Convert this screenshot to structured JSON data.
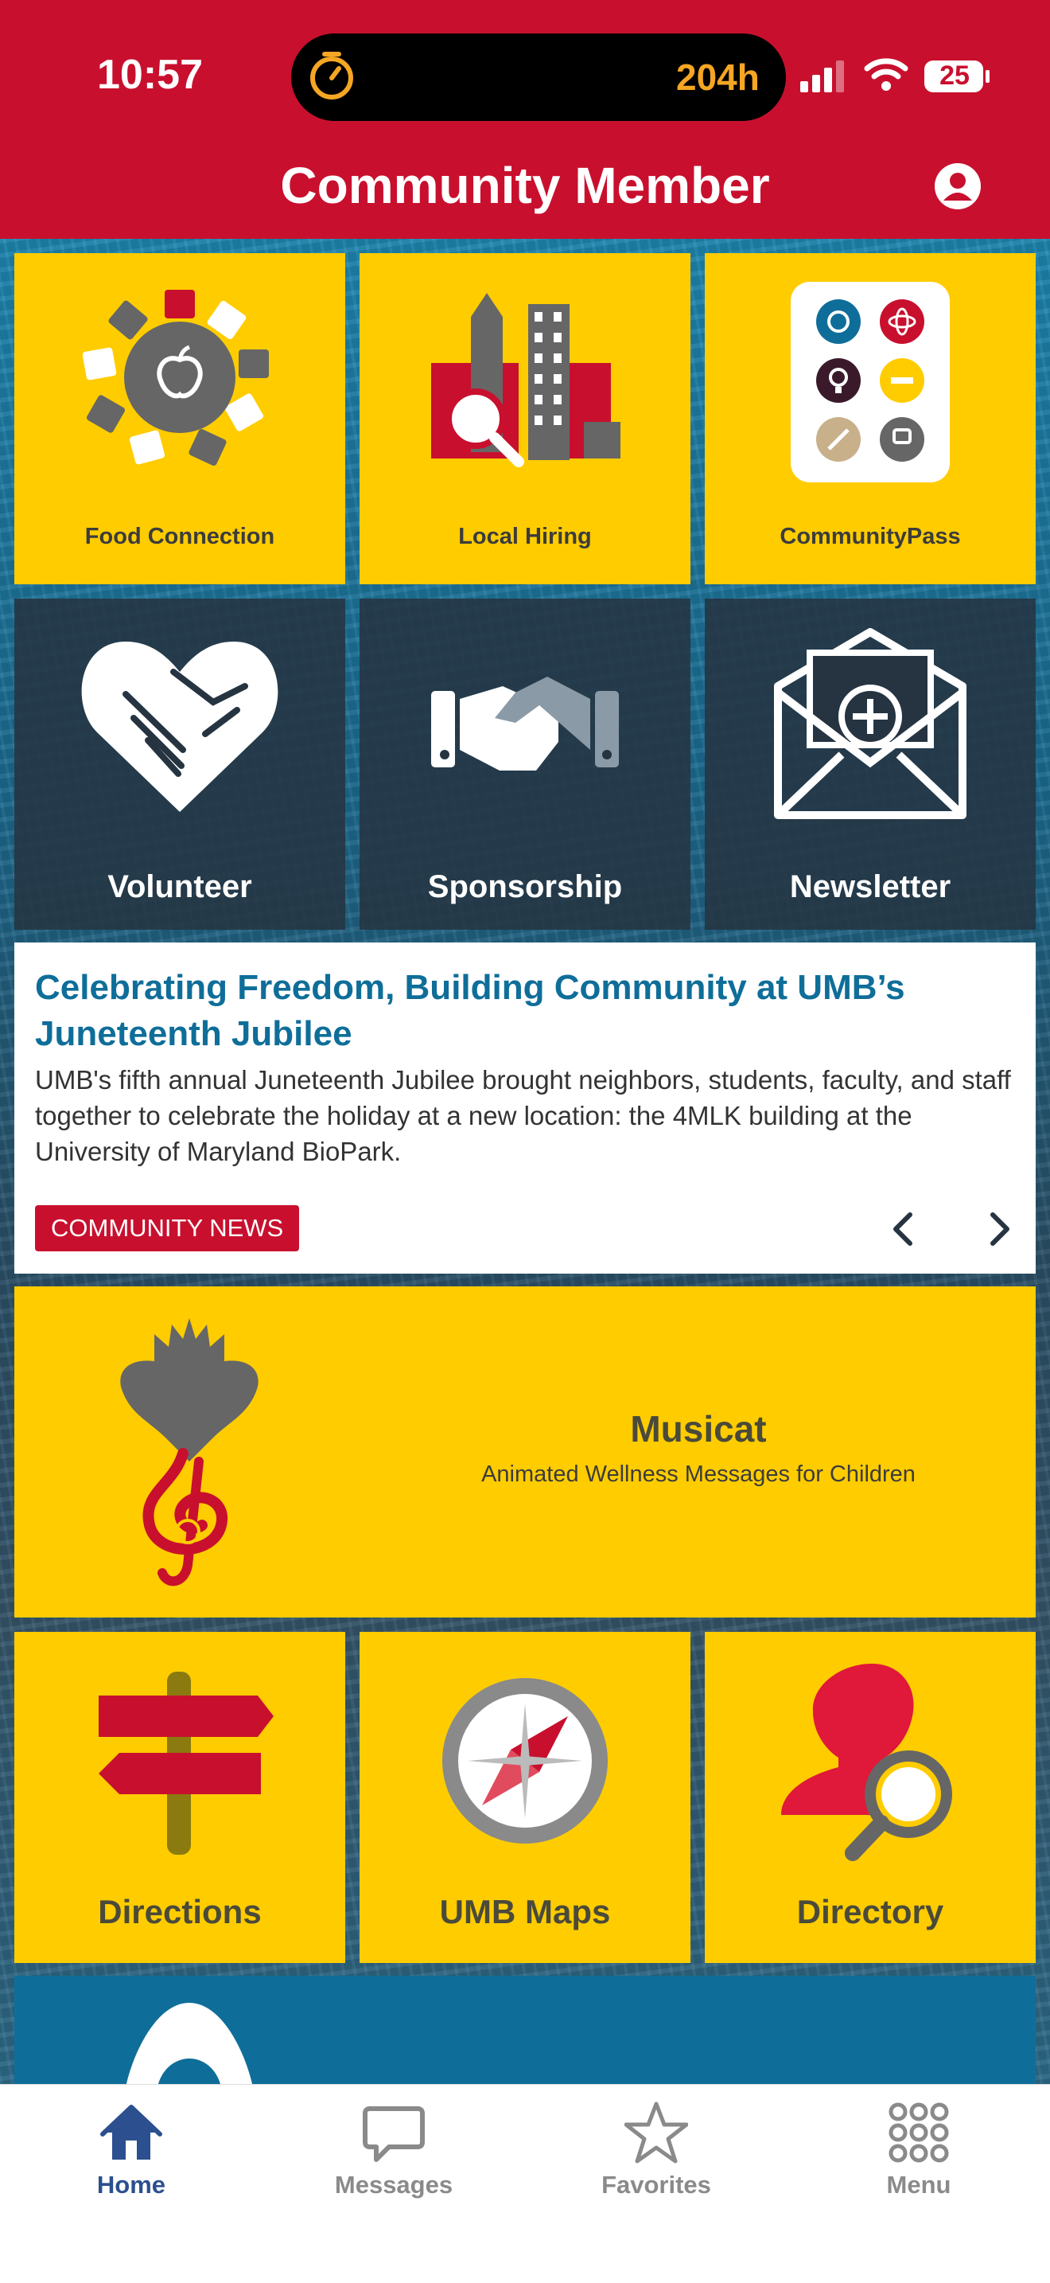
{
  "status_bar": {
    "time": "10:57",
    "timer": "204h",
    "battery": "25"
  },
  "header": {
    "title": "Community Member"
  },
  "tiles_row1": [
    {
      "label": "Food Connection",
      "icon": "food-connection-icon"
    },
    {
      "label": "Local Hiring",
      "icon": "local-hiring-icon"
    },
    {
      "label": "CommunityPass",
      "icon": "community-pass-icon"
    }
  ],
  "tiles_row2": [
    {
      "label": "Volunteer",
      "icon": "heart-hands-icon"
    },
    {
      "label": "Sponsorship",
      "icon": "handshake-icon"
    },
    {
      "label": "Newsletter",
      "icon": "envelope-plus-icon"
    }
  ],
  "news": {
    "title": "Celebrating Freedom, Building Community at UMB’s Juneteenth Jubilee",
    "body": "UMB's fifth annual Juneteenth Jubilee brought neighbors, students, faculty, and staff together to celebrate the holiday at a new location: the 4MLK building at the University of Maryland BioPark.",
    "tag": "COMMUNITY NEWS"
  },
  "banner": {
    "title": "Musicat",
    "subtitle": "Animated Wellness Messages for Children"
  },
  "tiles_row3": [
    {
      "label": "Directions",
      "icon": "signpost-icon"
    },
    {
      "label": "UMB Maps",
      "icon": "compass-icon"
    },
    {
      "label": "Directory",
      "icon": "person-search-icon"
    }
  ],
  "tabbar": [
    {
      "label": "Home",
      "icon": "home-icon",
      "active": true
    },
    {
      "label": "Messages",
      "icon": "chat-bubble-icon",
      "active": false
    },
    {
      "label": "Favorites",
      "icon": "star-icon",
      "active": false
    },
    {
      "label": "Menu",
      "icon": "grid-dots-icon",
      "active": false
    }
  ],
  "colors": {
    "brand_red": "#c8102e",
    "tile_yellow": "#ffcc00",
    "tile_dark": "#263442",
    "link_blue": "#0f6e99",
    "tab_active": "#2b4f8f"
  }
}
